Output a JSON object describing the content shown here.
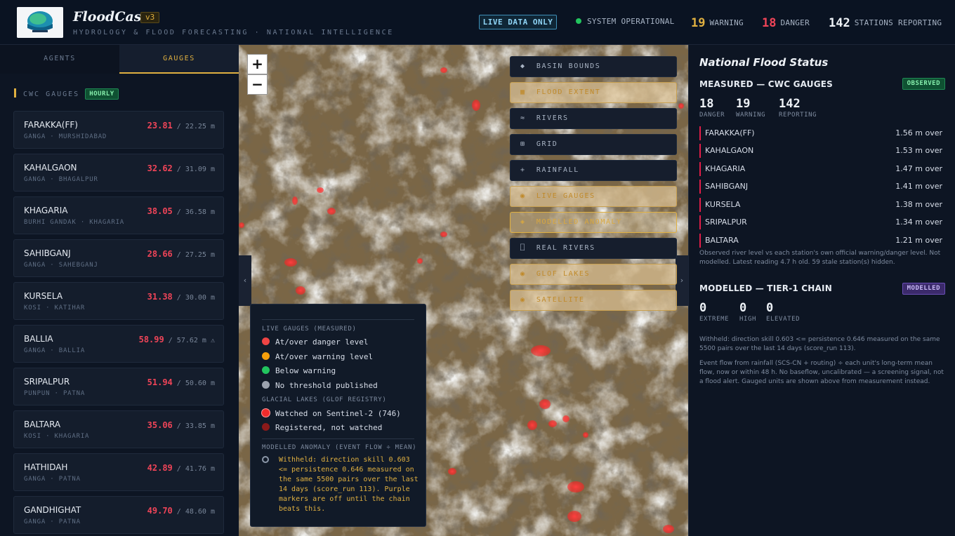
{
  "header": {
    "brand": "FloodCast",
    "version": "v3",
    "tagline": "HYDROLOGY & FLOOD FORECASTING · NATIONAL INTELLIGENCE",
    "live_pill": "LIVE DATA ONLY",
    "system_status": "SYSTEM OPERATIONAL",
    "warning_count": "19",
    "warning_label": "WARNING",
    "danger_count": "18",
    "danger_label": "DANGER",
    "stations_count": "142",
    "stations_label": "STATIONS REPORTING"
  },
  "left": {
    "tabs": [
      {
        "label": "AGENTS"
      },
      {
        "label": "GAUGES"
      }
    ],
    "section_title": "CWC GAUGES",
    "section_badge": "HOURLY",
    "gauges": [
      {
        "name": "FARAKKA(FF)",
        "sub": "GANGA · MURSHIDABAD",
        "level": "23.81",
        "threshold": " / 22.25 m",
        "flag": ""
      },
      {
        "name": "KAHALGAON",
        "sub": "GANGA · BHAGALPUR",
        "level": "32.62",
        "threshold": " / 31.09 m",
        "flag": ""
      },
      {
        "name": "KHAGARIA",
        "sub": "BURHI GANDAK · KHAGARIA",
        "level": "38.05",
        "threshold": " / 36.58 m",
        "flag": ""
      },
      {
        "name": "SAHIBGANJ",
        "sub": "GANGA · SAHEBGANJ",
        "level": "28.66",
        "threshold": " / 27.25 m",
        "flag": ""
      },
      {
        "name": "KURSELA",
        "sub": "KOSI · KATIHAR",
        "level": "31.38",
        "threshold": " / 30.00 m",
        "flag": ""
      },
      {
        "name": "BALLIA",
        "sub": "GANGA · BALLIA",
        "level": "58.99",
        "threshold": " / 57.62 m",
        "flag": " ⚠"
      },
      {
        "name": "SRIPALPUR",
        "sub": "PUNPUN · PATNA",
        "level": "51.94",
        "threshold": " / 50.60 m",
        "flag": ""
      },
      {
        "name": "BALTARA",
        "sub": "KOSI · KHAGARIA",
        "level": "35.06",
        "threshold": " / 33.85 m",
        "flag": ""
      },
      {
        "name": "HATHIDAH",
        "sub": "GANGA · PATNA",
        "level": "42.89",
        "threshold": " / 41.76 m",
        "flag": ""
      },
      {
        "name": "GANDHIGHAT",
        "sub": "GANGA · PATNA",
        "level": "49.70",
        "threshold": " / 48.60 m",
        "flag": ""
      }
    ]
  },
  "map": {
    "zoom_in": "+",
    "zoom_out": "−",
    "collapse_left": "‹",
    "collapse_right": "›",
    "layers": [
      {
        "icon": "◆",
        "label": "BASIN BOUNDS",
        "state": "off"
      },
      {
        "icon": "▦",
        "label": "FLOOD EXTENT",
        "state": "on"
      },
      {
        "icon": "≈",
        "label": "RIVERS",
        "state": "off"
      },
      {
        "icon": "⊞",
        "label": "GRID",
        "state": "off"
      },
      {
        "icon": "+",
        "label": "RAINFALL",
        "state": "off"
      },
      {
        "icon": "◉",
        "label": "LIVE GAUGES",
        "state": "on"
      },
      {
        "icon": "◈",
        "label": "MODELLED ANOMALY (WITHHELD)",
        "state": "outline"
      },
      {
        "icon": "⎕",
        "label": "REAL RIVERS",
        "state": "off"
      },
      {
        "icon": "◉",
        "label": "GLOF LAKES",
        "state": "on"
      },
      {
        "icon": "◉",
        "label": "SATELLITE",
        "state": "on"
      }
    ],
    "legend": {
      "live_title": "LIVE GAUGES (MEASURED)",
      "live_items": [
        {
          "label": "At/over danger level",
          "color": "#ef4444"
        },
        {
          "label": "At/over warning level",
          "color": "#f59e0b"
        },
        {
          "label": "Below warning",
          "color": "#22c55e"
        },
        {
          "label": "No threshold published",
          "color": "#9ca3af"
        }
      ],
      "glacial_title": "GLACIAL LAKES (GLOF REGISTRY)",
      "glacial_items": [
        {
          "label": "Watched on Sentinel-2 (746)",
          "color": "#ef2b2b"
        },
        {
          "label": "Registered, not watched",
          "color": "#8b1a1a"
        }
      ],
      "modelled_title": "MODELLED ANOMALY (EVENT FLOW ÷ MEAN)",
      "modelled_note": "Withheld: direction skill 0.603 <= persistence 0.646 measured on the same 5500 pairs over the last 14 days (score_run 113). Purple markers are off until the chain beats this."
    }
  },
  "right": {
    "title": "National Flood Status",
    "measured_title": "MEASURED — CWC GAUGES",
    "measured_badge": "OBSERVED",
    "danger": "18",
    "danger_label": "DANGER",
    "warning": "19",
    "warning_label": "WARNING",
    "reporting": "142",
    "reporting_label": "REPORTING",
    "over_rows": [
      {
        "name": "FARAKKA(FF)",
        "amount": "1.56 m over"
      },
      {
        "name": "KAHALGAON",
        "amount": "1.53 m over"
      },
      {
        "name": "KHAGARIA",
        "amount": "1.47 m over"
      },
      {
        "name": "SAHIBGANJ",
        "amount": "1.41 m over"
      },
      {
        "name": "KURSELA",
        "amount": "1.38 m over"
      },
      {
        "name": "SRIPALPUR",
        "amount": "1.34 m over"
      },
      {
        "name": "BALTARA",
        "amount": "1.21 m over"
      }
    ],
    "measured_note": "Observed river level vs each station's own official warning/danger level. Not modelled. Latest reading 4.7 h old. 59 stale station(s) hidden.",
    "modelled_title": "MODELLED — TIER-1 CHAIN",
    "modelled_badge": "MODELLED",
    "extreme": "0",
    "extreme_label": "EXTREME",
    "high": "0",
    "high_label": "HIGH",
    "elevated": "0",
    "elevated_label": "ELEVATED",
    "withheld_note": "Withheld: direction skill 0.603 <= persistence 0.646 measured on the same 5500 pairs over the last 14 days (score_run 113).",
    "event_note": "Event flow from rainfall (SCS-CN + routing) ÷ each unit's long-term mean flow, now or within 48 h. No baseflow, uncalibrated — a screening signal, not a flood alert. Gauged units are shown above from measurement instead."
  },
  "colors": {
    "accent": "#e0b040",
    "danger": "#ef4458",
    "ok": "#22c55e",
    "background": "#0b1320"
  }
}
